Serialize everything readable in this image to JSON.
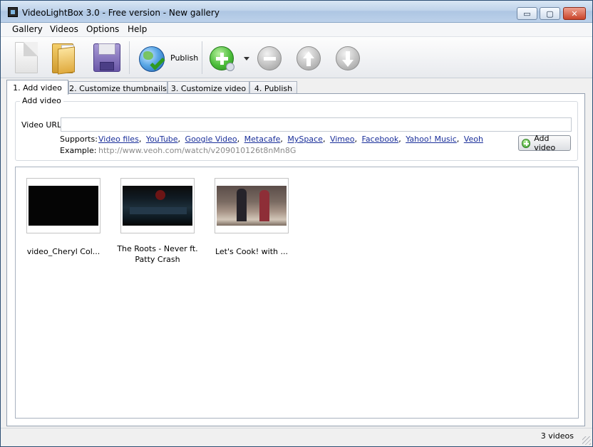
{
  "window": {
    "title": "VideoLightBox 3.0 - Free version - New gallery",
    "controls": {
      "minimize": "▭",
      "maximize": "▢",
      "close": "✕"
    }
  },
  "menu": {
    "gallery": "Gallery",
    "videos": "Videos",
    "options": "Options",
    "help": "Help"
  },
  "toolbar": {
    "publish_label": "Publish",
    "icons": [
      "new-document-icon",
      "open-folder-icon",
      "save-disk-icon",
      "publish-globe-icon",
      "add-icon",
      "remove-icon",
      "move-up-icon",
      "move-down-icon"
    ]
  },
  "tabs": [
    {
      "label": "1. Add video",
      "active": true
    },
    {
      "label": "2. Customize thumbnails",
      "active": false
    },
    {
      "label": "3. Customize video",
      "active": false
    },
    {
      "label": "4. Publish",
      "active": false
    }
  ],
  "add_video": {
    "legend": "Add video",
    "url_label": "Video URL",
    "url_value": "",
    "supports_label": "Supports:",
    "supports_links": [
      "Video files",
      "YouTube",
      "Google Video",
      "Metacafe",
      "MySpace",
      "Vimeo",
      "Facebook",
      "Yahoo! Music",
      "Veoh"
    ],
    "example_label": "Example:",
    "example_value": "http://www.veoh.com/watch/v209010126t8nMn8G",
    "button_label": "Add video"
  },
  "gallery": {
    "items": [
      {
        "caption": "video_Cheryl Col..."
      },
      {
        "caption": "The Roots - Never ft. Patty Crash"
      },
      {
        "caption": "Let's Cook! with ..."
      }
    ]
  },
  "status": {
    "count_text": "3 videos"
  },
  "colors": {
    "link": "#1a2f9a",
    "accent_green": "#4bbd3a",
    "titlebar": "#bfd3ea"
  }
}
